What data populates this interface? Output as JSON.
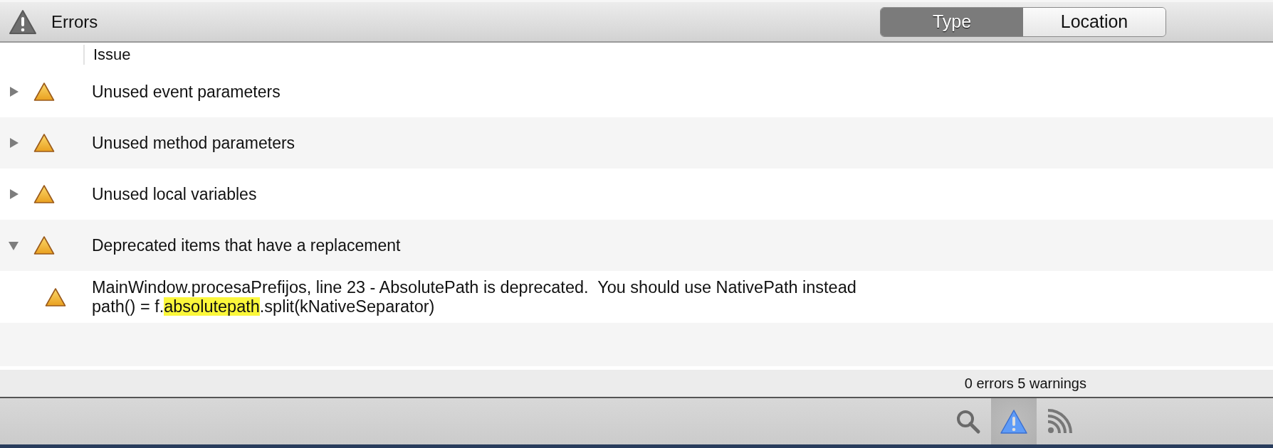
{
  "header": {
    "title": "Errors"
  },
  "segments": [
    {
      "label": "Type",
      "selected": true
    },
    {
      "label": "Location",
      "selected": false
    }
  ],
  "table": {
    "columns": [
      "Issue"
    ],
    "rows": [
      {
        "label": "Unused event parameters",
        "expanded": false,
        "children": []
      },
      {
        "label": "Unused method parameters",
        "expanded": false,
        "children": []
      },
      {
        "label": "Unused local variables",
        "expanded": false,
        "children": []
      },
      {
        "label": "Deprecated items that have a replacement",
        "expanded": true,
        "children": [
          {
            "message": "MainWindow.procesaPrefijos, line 23 - AbsolutePath is deprecated.  You should use NativePath instead",
            "code": {
              "before": "path() = f.",
              "highlight": "absolutepath",
              "after": ".split(kNativeSeparator)"
            }
          }
        ]
      }
    ]
  },
  "status_bar": {
    "summary": "0 errors 5 warnings"
  },
  "toolbar": [
    {
      "kind": "search",
      "selected": false
    },
    {
      "kind": "warning",
      "selected": true
    },
    {
      "kind": "feed",
      "selected": false
    }
  ]
}
